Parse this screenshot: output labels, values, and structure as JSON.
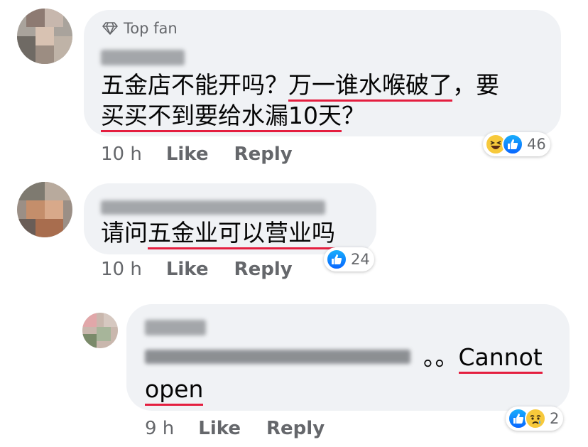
{
  "comments": [
    {
      "badge": "Top fan",
      "text_segments": [
        {
          "t": "五金店不能开吗？",
          "u": false
        },
        {
          "t": "万一谁水喉破了",
          "u": true
        },
        {
          "t": "，要",
          "u": false
        }
      ],
      "text_segments_2": [
        {
          "t": "买买不到要给水漏10天",
          "u": true
        },
        {
          "t": "？",
          "u": false
        }
      ],
      "time": "10 h",
      "like": "Like",
      "reply": "Reply",
      "reactions": [
        "haha",
        "like"
      ],
      "count": "46"
    },
    {
      "text_segments": [
        {
          "t": "请问",
          "u": false
        },
        {
          "t": "五金业可以营业吗",
          "u": true
        }
      ],
      "time": "10 h",
      "like": "Like",
      "reply": "Reply",
      "reactions": [
        "like"
      ],
      "count": "24"
    },
    {
      "text_tail": "。。",
      "text_u1": "Cannot",
      "text_u2": "open",
      "time": "9 h",
      "like": "Like",
      "reply": "Reply",
      "reactions": [
        "like",
        "sad"
      ],
      "count": "2"
    }
  ]
}
